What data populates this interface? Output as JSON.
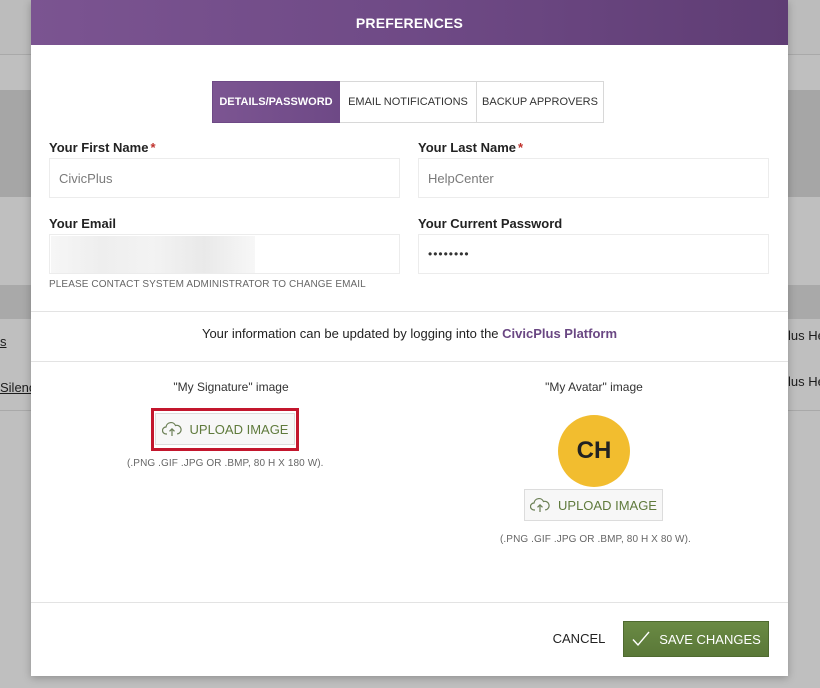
{
  "background": {
    "left_link_1": "s",
    "left_link_2": "Silenc",
    "right_text_1": "lus He",
    "right_text_2": "lus He"
  },
  "modal": {
    "title": "PREFERENCES",
    "tabs": [
      {
        "label": "DETAILS/PASSWORD",
        "active": true
      },
      {
        "label": "EMAIL NOTIFICATIONS",
        "active": false
      },
      {
        "label": "BACKUP APPROVERS",
        "active": false
      }
    ],
    "form": {
      "first_name_label": "Your First Name",
      "first_name_value": "CivicPlus",
      "last_name_label": "Your Last Name",
      "last_name_value": "HelpCenter",
      "required_marker": "*",
      "email_label": "Your Email",
      "email_helper": "PLEASE CONTACT SYSTEM ADMINISTRATOR TO CHANGE EMAIL",
      "password_label": "Your Current Password",
      "password_value": "••••••••"
    },
    "info": {
      "text": "Your information can be updated by logging into the ",
      "link_label": "CivicPlus Platform"
    },
    "signature": {
      "caption": "\"My Signature\" image",
      "button_label": "UPLOAD IMAGE",
      "format_hint": "(.PNG .GIF .JPG OR .BMP, 80 H X 180 W)."
    },
    "avatar": {
      "caption": "\"My Avatar\" image",
      "initials": "CH",
      "button_label": "UPLOAD IMAGE",
      "format_hint": "(.PNG .GIF .JPG OR .BMP, 80 H X 80 W)."
    },
    "footer": {
      "cancel_label": "CANCEL",
      "save_label": "SAVE CHANGES"
    }
  },
  "colors": {
    "header_purple": "#6f4a86",
    "accent_green": "#5f7a3c",
    "avatar_yellow": "#f2bd2f",
    "highlight_red": "#c3162d",
    "required_red": "#c0322c"
  },
  "icons": {
    "upload": "cloud-upload-icon",
    "save": "checkmark-icon"
  }
}
